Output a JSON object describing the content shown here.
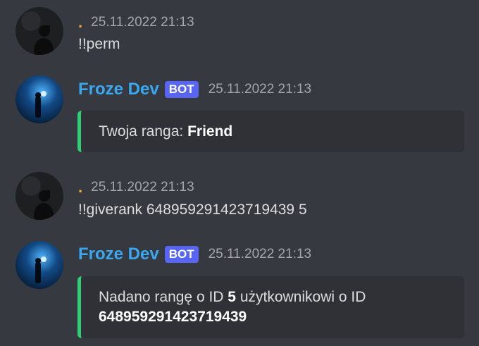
{
  "messages": [
    {
      "username": ".",
      "timestamp": "25.11.2022 21:13",
      "text": "!!perm"
    },
    {
      "username": "Froze Dev",
      "badge": "BOT",
      "timestamp": "25.11.2022 21:13",
      "embed": {
        "prefix": "Twoja ranga: ",
        "rank": "Friend"
      }
    },
    {
      "username": ".",
      "timestamp": "25.11.2022 21:13",
      "text": "!!giverank 648959291423719439 5"
    },
    {
      "username": "Froze Dev",
      "badge": "BOT",
      "timestamp": "25.11.2022 21:13",
      "embed": {
        "part1": "Nadano rangę o ID ",
        "rank_id": "5",
        "part2": " użytkownikowi o ID",
        "user_id": "648959291423719439"
      }
    }
  ],
  "colors": {
    "background": "#36393f",
    "embed_background": "#2f3136",
    "embed_accent": "#2fd073",
    "bot_name": "#3aa8f0",
    "bot_badge": "#5865f2",
    "user_name": "#f0b232"
  }
}
